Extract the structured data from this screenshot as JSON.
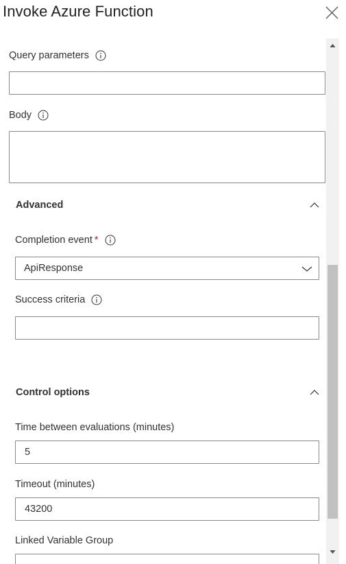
{
  "dialog": {
    "title": "Invoke Azure Function",
    "close_icon": "close-icon"
  },
  "fields": {
    "query_parameters": {
      "label": "Query parameters",
      "value": ""
    },
    "body": {
      "label": "Body",
      "value": ""
    }
  },
  "advanced": {
    "header": "Advanced",
    "completion_event": {
      "label": "Completion event",
      "required_marker": "*",
      "selected": "ApiResponse"
    },
    "success_criteria": {
      "label": "Success criteria",
      "value": ""
    }
  },
  "control_options": {
    "header": "Control options",
    "time_between_evaluations": {
      "label": "Time between evaluations (minutes)",
      "value": "5"
    },
    "timeout": {
      "label": "Timeout (minutes)",
      "value": "43200"
    },
    "linked_variable_group": {
      "label": "Linked Variable Group",
      "value": ""
    }
  },
  "icons": {
    "info": "info-icon",
    "chevron_up": "chevron-up-icon",
    "chevron_down": "chevron-down-icon",
    "scroll_up": "scroll-up-arrow-icon",
    "scroll_down": "scroll-down-arrow-icon"
  },
  "colors": {
    "required": "#a4262c",
    "border": "#8a8886",
    "text": "#323130"
  }
}
